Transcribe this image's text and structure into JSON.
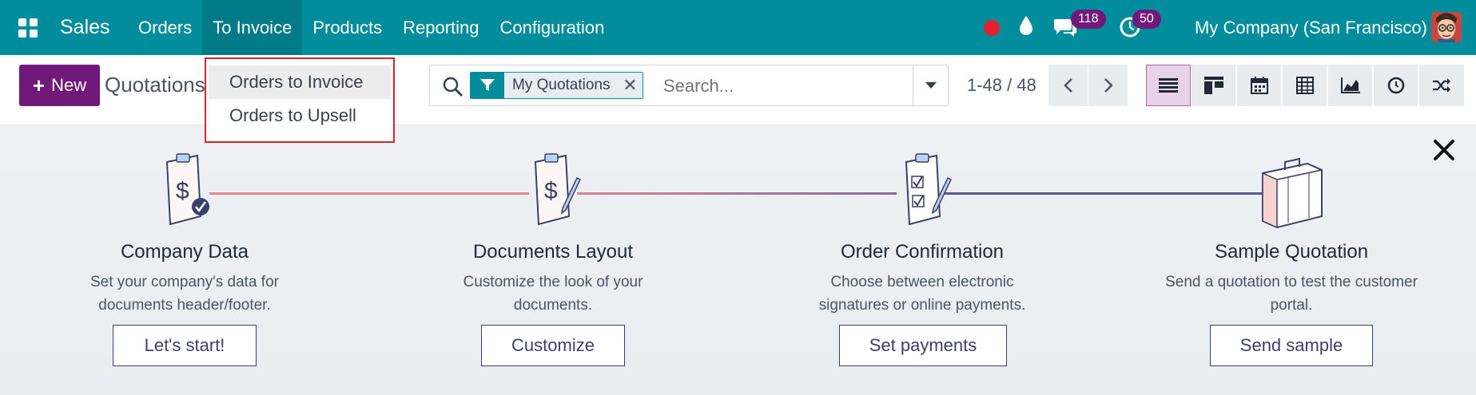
{
  "navbar": {
    "brand": "Sales",
    "menu": [
      {
        "label": "Orders",
        "active": false
      },
      {
        "label": "To Invoice",
        "active": true
      },
      {
        "label": "Products",
        "active": false
      },
      {
        "label": "Reporting",
        "active": false
      },
      {
        "label": "Configuration",
        "active": false
      }
    ],
    "messages_count": "118",
    "activities_count": "50",
    "company": "My Company (San Francisco)"
  },
  "dropdown": {
    "items": [
      "Orders to Invoice",
      "Orders to Upsell"
    ]
  },
  "control": {
    "new_label": "New",
    "title": "Quotations",
    "facet_label": "My Quotations",
    "search_placeholder": "Search...",
    "pager": "1-48 / 48"
  },
  "onboarding": {
    "steps": [
      {
        "title": "Company Data",
        "desc": "Set your company's data for documents header/footer.",
        "button": "Let's start!"
      },
      {
        "title": "Documents Layout",
        "desc": "Customize the look of your documents.",
        "button": "Customize"
      },
      {
        "title": "Order Confirmation",
        "desc": "Choose between electronic signatures or online payments.",
        "button": "Set payments"
      },
      {
        "title": "Sample Quotation",
        "desc": "Send a quotation to test the customer portal.",
        "button": "Send sample"
      }
    ]
  },
  "colors": {
    "navbar": "#018d9b",
    "brand_purple": "#71197a",
    "highlight_box": "#d9252a",
    "step_button": "#3c3f6b"
  },
  "icons": [
    "apps-grid-icon",
    "record-icon",
    "drop-icon",
    "chat-icon",
    "clock-icon",
    "search-icon",
    "filter-icon",
    "caret-down-icon",
    "chevron-left-icon",
    "chevron-right-icon",
    "list-view-icon",
    "kanban-view-icon",
    "calendar-view-icon",
    "pivot-view-icon",
    "graph-view-icon",
    "activity-view-icon",
    "map-view-icon",
    "close-icon"
  ]
}
